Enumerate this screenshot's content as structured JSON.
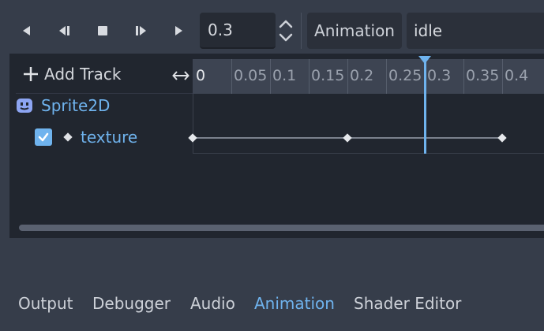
{
  "toolbar": {
    "time_value": "0.3",
    "animation_menu_label": "Animation",
    "animation_name": "idle"
  },
  "tracks": {
    "add_track_label": "Add Track",
    "node_name": "Sprite2D",
    "property_name": "texture",
    "property_enabled": true
  },
  "timeline": {
    "ticks": [
      "0",
      "0.05",
      "0.1",
      "0.15",
      "0.2",
      "0.25",
      "0.3",
      "0.35",
      "0.4"
    ],
    "playhead_time": 0.3,
    "keyframes": [
      0,
      0.2,
      0.4
    ]
  },
  "bottom_tabs": [
    {
      "label": "Output",
      "active": false
    },
    {
      "label": "Debugger",
      "active": false
    },
    {
      "label": "Audio",
      "active": false
    },
    {
      "label": "Animation",
      "active": true
    },
    {
      "label": "Shader Editor",
      "active": false
    }
  ],
  "colors": {
    "accent": "#6fb3ee",
    "panel_bg": "#21262f",
    "window_bg": "#363d4a"
  }
}
